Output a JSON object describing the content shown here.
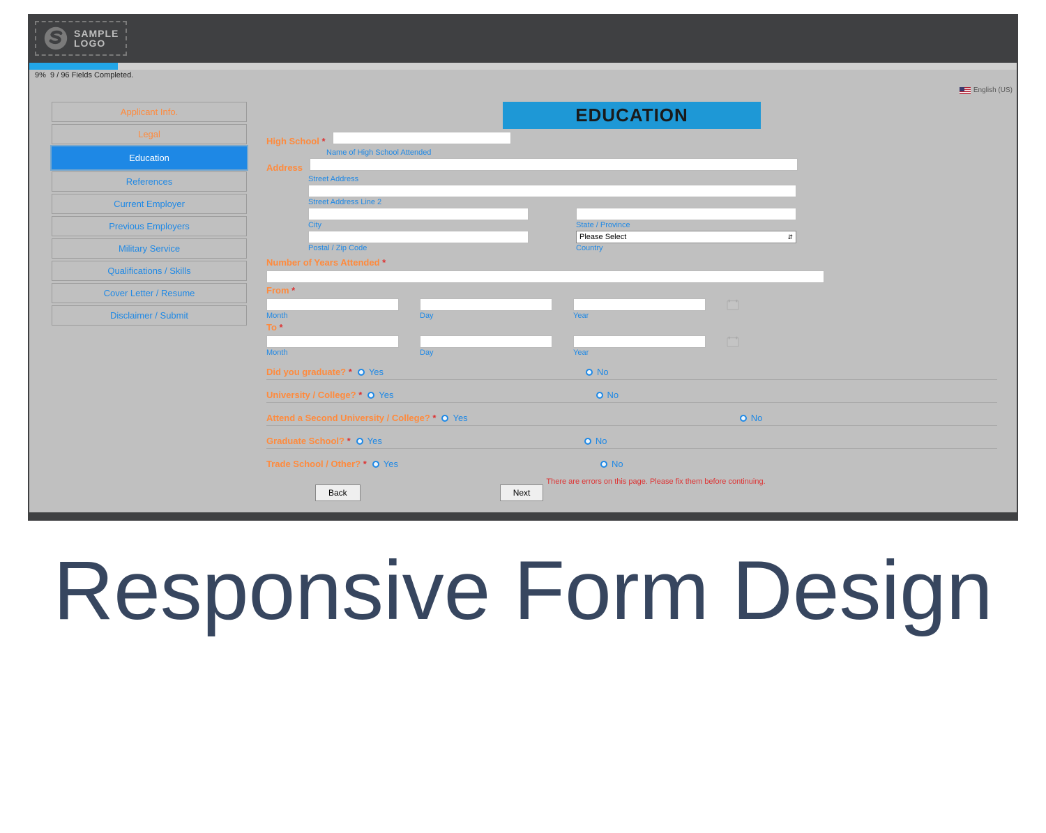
{
  "logo": {
    "top": "SAMPLE",
    "bottom": "LOGO"
  },
  "progress": {
    "percent": "9%",
    "text": "9 / 96 Fields Completed.",
    "fill_pct": 9
  },
  "language": "English (US)",
  "sidebar": {
    "items": [
      {
        "label": "Applicant Info.",
        "style": "orange"
      },
      {
        "label": "Legal",
        "style": "orange"
      },
      {
        "label": "Education",
        "style": "active"
      },
      {
        "label": "References",
        "style": "blue"
      },
      {
        "label": "Current Employer",
        "style": "blue"
      },
      {
        "label": "Previous Employers",
        "style": "blue"
      },
      {
        "label": "Military Service",
        "style": "blue"
      },
      {
        "label": "Qualifications / Skills",
        "style": "blue"
      },
      {
        "label": "Cover Letter / Resume",
        "style": "blue"
      },
      {
        "label": "Disclaimer / Submit",
        "style": "blue"
      }
    ]
  },
  "form": {
    "header": "EDUCATION",
    "high_school": {
      "label": "High School",
      "hint": "Name of High School Attended"
    },
    "address": {
      "label": "Address",
      "street": "Street Address",
      "street2": "Street Address Line 2",
      "city": "City",
      "state": "State / Province",
      "postal": "Postal / Zip Code",
      "country": "Country",
      "country_placeholder": "Please Select"
    },
    "years_attended": "Number of Years Attended",
    "from": {
      "label": "From",
      "month": "Month",
      "day": "Day",
      "year": "Year"
    },
    "to": {
      "label": "To",
      "month": "Month",
      "day": "Day",
      "year": "Year"
    },
    "questions": {
      "graduate": "Did you graduate?",
      "univ": "University / College?",
      "second_univ": "Attend a Second University / College?",
      "grad_school": "Graduate School?",
      "trade": "Trade School / Other?"
    },
    "yes": "Yes",
    "no": "No",
    "required_mark": "*",
    "error": "There are errors on this page. Please fix them before continuing.",
    "back": "Back",
    "next": "Next"
  },
  "caption": "Responsive Form Design"
}
